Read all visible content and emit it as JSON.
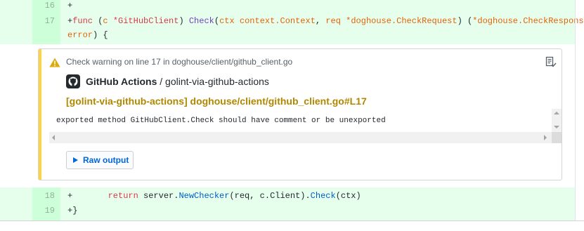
{
  "diff": {
    "lines_top": [
      {
        "num": "16",
        "tokens": [
          {
            "t": "+",
            "c": ""
          }
        ]
      },
      {
        "num": "17",
        "tokens": [
          {
            "t": "+",
            "c": ""
          },
          {
            "t": "func",
            "c": "kw"
          },
          {
            "t": " (",
            "c": ""
          },
          {
            "t": "c",
            "c": "ty"
          },
          {
            "t": " ",
            "c": ""
          },
          {
            "t": "*GitHubClient",
            "c": "kw"
          },
          {
            "t": ") ",
            "c": ""
          },
          {
            "t": "Check",
            "c": "fn"
          },
          {
            "t": "(",
            "c": ""
          },
          {
            "t": "ctx",
            "c": "ty"
          },
          {
            "t": " ",
            "c": ""
          },
          {
            "t": "context.Context",
            "c": "ty"
          },
          {
            "t": ", ",
            "c": ""
          },
          {
            "t": "req",
            "c": "ty"
          },
          {
            "t": " ",
            "c": ""
          },
          {
            "t": "*doghouse.CheckRequest",
            "c": "ty"
          },
          {
            "t": ") (",
            "c": ""
          },
          {
            "t": "*doghouse.CheckResponse",
            "c": "ty"
          },
          {
            "t": ",",
            "c": ""
          }
        ]
      },
      {
        "num": "",
        "tokens": [
          {
            "t": "error",
            "c": "ty"
          },
          {
            "t": ") {",
            "c": ""
          }
        ]
      }
    ],
    "lines_bottom": [
      {
        "num": "18",
        "tokens": [
          {
            "t": "+       ",
            "c": ""
          },
          {
            "t": "return",
            "c": "kw"
          },
          {
            "t": " server.",
            "c": ""
          },
          {
            "t": "NewChecker",
            "c": "cl"
          },
          {
            "t": "(req, c.Client).",
            "c": ""
          },
          {
            "t": "Check",
            "c": "cl"
          },
          {
            "t": "(ctx)",
            "c": ""
          }
        ]
      },
      {
        "num": "19",
        "tokens": [
          {
            "t": "+}",
            "c": ""
          }
        ]
      }
    ]
  },
  "annotation": {
    "title": "Check warning on line 17 in doghouse/client/github_client.go",
    "app_name": "GitHub Actions",
    "separator": " / ",
    "check_name": "golint-via-github-actions",
    "path_link": "[golint-via-github-actions] doghouse/client/github_client.go#L17",
    "message": "exported method GitHubClient.Check should have comment or be unexported",
    "raw_output_label": "Raw output",
    "level": "warning",
    "colors": {
      "stripe": "#ffd33d",
      "link": "#b08800",
      "button_text": "#0366d6",
      "diff_added_bg": "#e6ffed"
    },
    "icons": [
      "alert-icon",
      "copy-icon",
      "github-mark-icon",
      "triangle-right-icon"
    ]
  }
}
